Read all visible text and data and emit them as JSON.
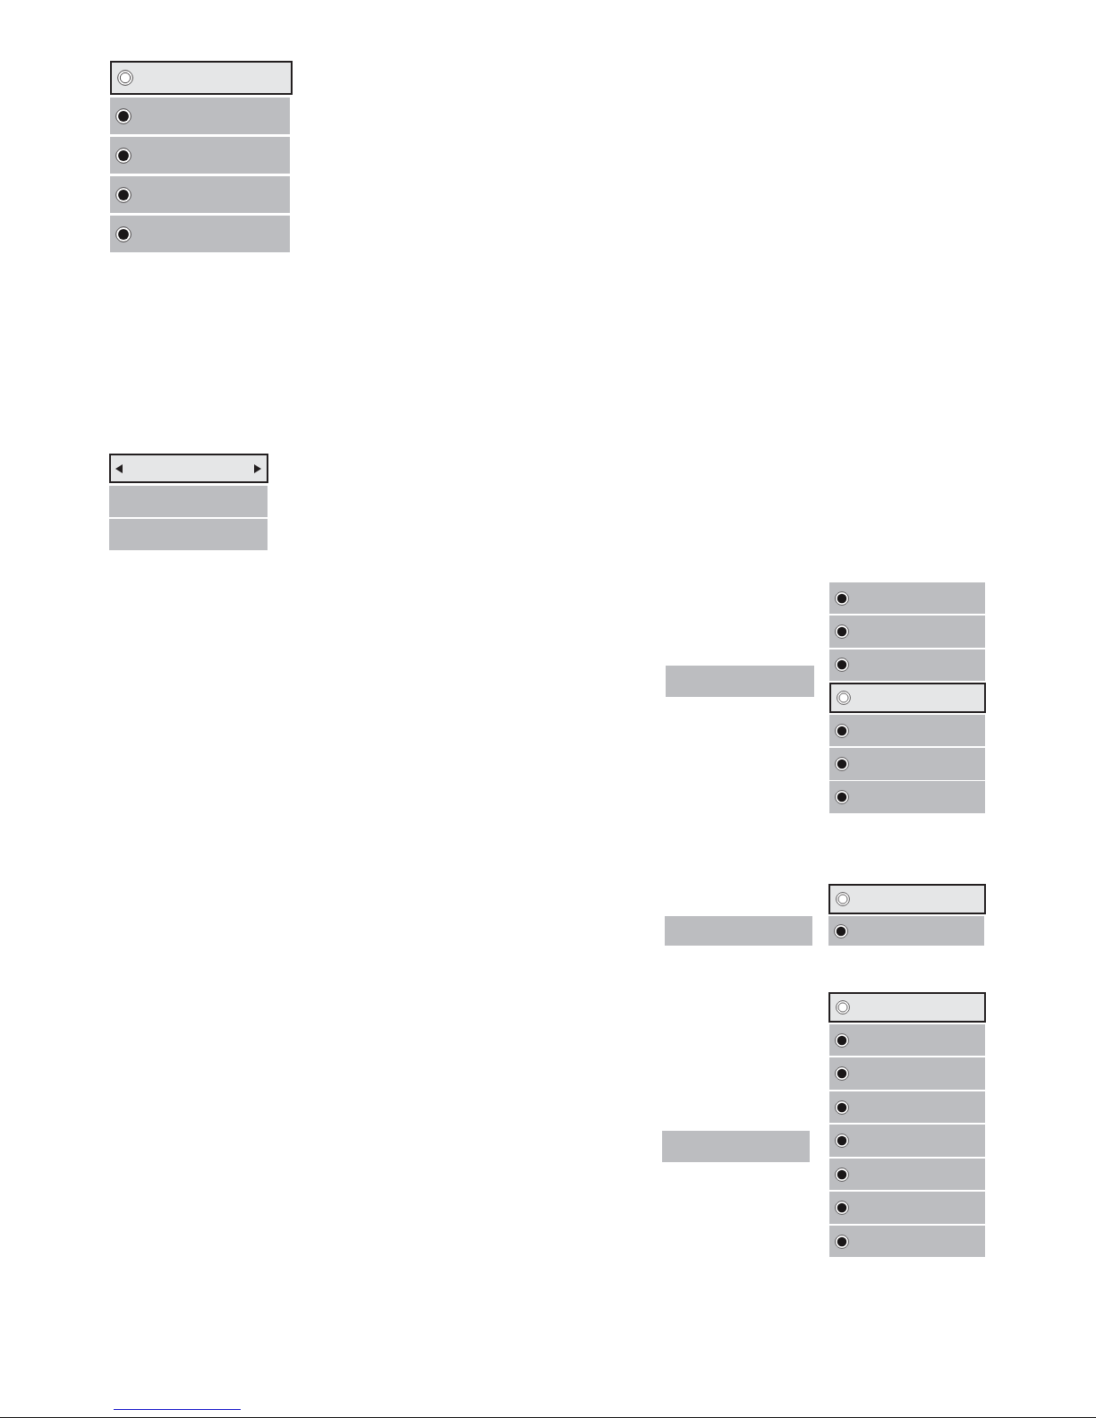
{
  "menus": [
    {
      "kind": "list",
      "items": [
        {
          "kind": "radio",
          "selected": true
        },
        {
          "kind": "radio",
          "selected": false
        },
        {
          "kind": "radio",
          "selected": false
        },
        {
          "kind": "radio",
          "selected": false
        },
        {
          "kind": "radio",
          "selected": false
        }
      ]
    },
    {
      "kind": "list",
      "items": [
        {
          "kind": "arrows",
          "selected": true
        },
        {
          "kind": "plain",
          "selected": false
        },
        {
          "kind": "plain",
          "selected": false
        }
      ]
    },
    {
      "kind": "submenu",
      "parent": {
        "selected": false
      },
      "items": [
        {
          "kind": "radio",
          "selected": false
        },
        {
          "kind": "radio",
          "selected": false
        },
        {
          "kind": "radio",
          "selected": false
        },
        {
          "kind": "radio",
          "selected": true
        },
        {
          "kind": "radio",
          "selected": false
        },
        {
          "kind": "radio",
          "selected": false
        },
        {
          "kind": "radio",
          "selected": false
        }
      ]
    },
    {
      "kind": "submenu",
      "parent": {
        "selected": false
      },
      "items": [
        {
          "kind": "radio",
          "selected": true
        },
        {
          "kind": "radio",
          "selected": false
        }
      ]
    },
    {
      "kind": "submenu",
      "parent": {
        "selected": false
      },
      "items": [
        {
          "kind": "radio",
          "selected": true
        },
        {
          "kind": "radio",
          "selected": false
        },
        {
          "kind": "radio",
          "selected": false
        },
        {
          "kind": "radio",
          "selected": false
        },
        {
          "kind": "radio",
          "selected": false
        },
        {
          "kind": "radio",
          "selected": false
        },
        {
          "kind": "radio",
          "selected": false
        },
        {
          "kind": "radio",
          "selected": false
        }
      ]
    }
  ]
}
